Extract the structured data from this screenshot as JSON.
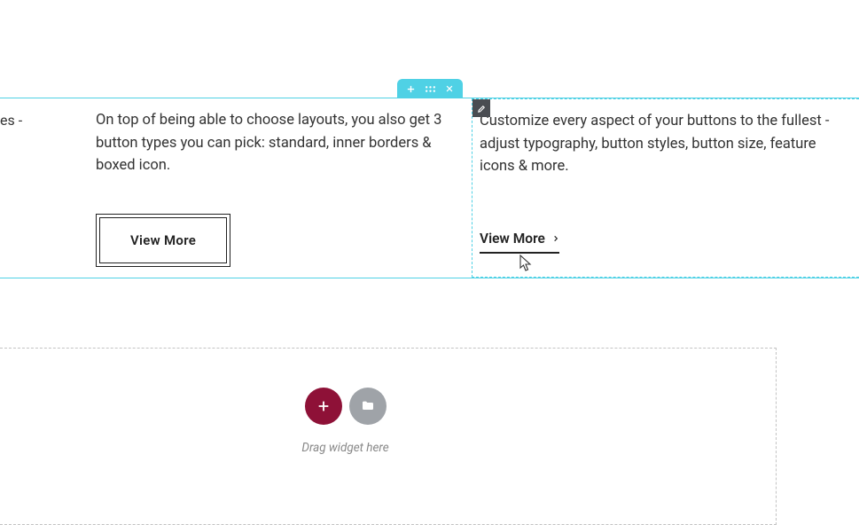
{
  "section": {
    "partial_text": "es -",
    "columns": [
      {
        "text": "On top of being able to choose layouts, you also get 3 button types you can pick: standard, inner borders & boxed icon.",
        "button": {
          "label": "View More",
          "style": "boxed"
        }
      },
      {
        "text": "Customize every aspect of your buttons to the fullest - adjust typography, button styles, button size, feature icons & more.",
        "button": {
          "label": "View More",
          "style": "underline-arrow"
        }
      }
    ]
  },
  "dropzone": {
    "hint": "Drag widget here"
  }
}
